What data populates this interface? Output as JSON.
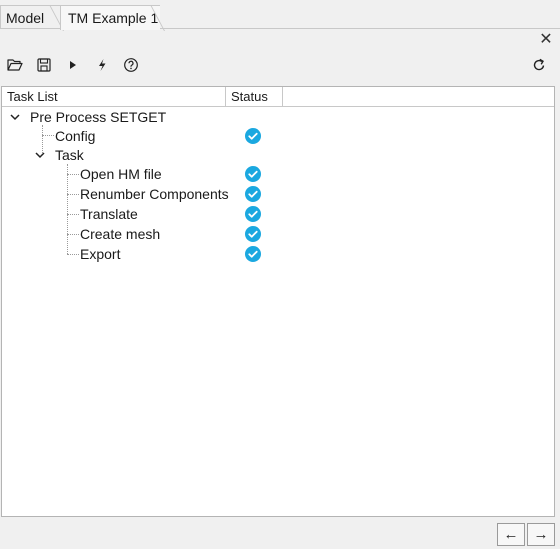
{
  "tabs": [
    {
      "label": "Model"
    },
    {
      "label": "TM Example 1",
      "active": true
    }
  ],
  "toolbar": {
    "items": [
      {
        "icon": "folder-open-icon"
      },
      {
        "icon": "save-icon"
      },
      {
        "icon": "play-icon"
      },
      {
        "icon": "lightning-icon"
      },
      {
        "icon": "help-icon"
      },
      {
        "icon": "refresh-icon"
      }
    ]
  },
  "table": {
    "columns": [
      "Task List",
      "Status"
    ],
    "rows": [
      {
        "label": "Pre Process SETGET",
        "level": 0,
        "expanded": true
      },
      {
        "label": "Config",
        "level": 1,
        "status": "complete"
      },
      {
        "label": "Task",
        "level": 1,
        "expanded": true
      },
      {
        "label": "Open HM file",
        "level": 2,
        "status": "complete"
      },
      {
        "label": "Renumber Components",
        "level": 2,
        "status": "complete"
      },
      {
        "label": "Translate",
        "level": 2,
        "status": "complete"
      },
      {
        "label": "Create mesh",
        "level": 2,
        "status": "complete"
      },
      {
        "label": "Export",
        "level": 2,
        "status": "complete"
      }
    ]
  },
  "nav": {
    "prev": "←",
    "next": "→"
  },
  "close_glyph": "✕",
  "colors": {
    "status_complete": "#1ba8e0",
    "panel_bg": "#f0f0f0"
  }
}
